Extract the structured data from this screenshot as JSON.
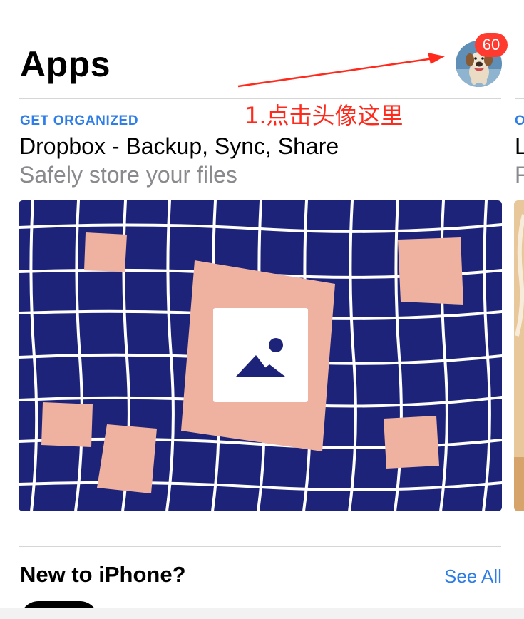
{
  "header": {
    "title": "Apps",
    "badge_count": "60"
  },
  "annotation": {
    "text": "1.点击头像这里"
  },
  "featured_card": {
    "category": "GET ORGANIZED",
    "title": "Dropbox - Backup, Sync, Share",
    "subtitle": "Safely store your files"
  },
  "next_card_peek": {
    "category": "O",
    "title": "L",
    "subtitle": "F"
  },
  "section": {
    "title": "New to iPhone?",
    "see_all_label": "See All"
  },
  "colors": {
    "accent_blue": "#2f7ee8",
    "badge_red": "#ff3b30",
    "annotation_red": "#ff2a1c",
    "illustration_navy": "#1c2378",
    "illustration_pink": "#efb2a1"
  },
  "icons": {
    "avatar": "dog-photo-avatar",
    "illustration": "image-placeholder-icon"
  }
}
